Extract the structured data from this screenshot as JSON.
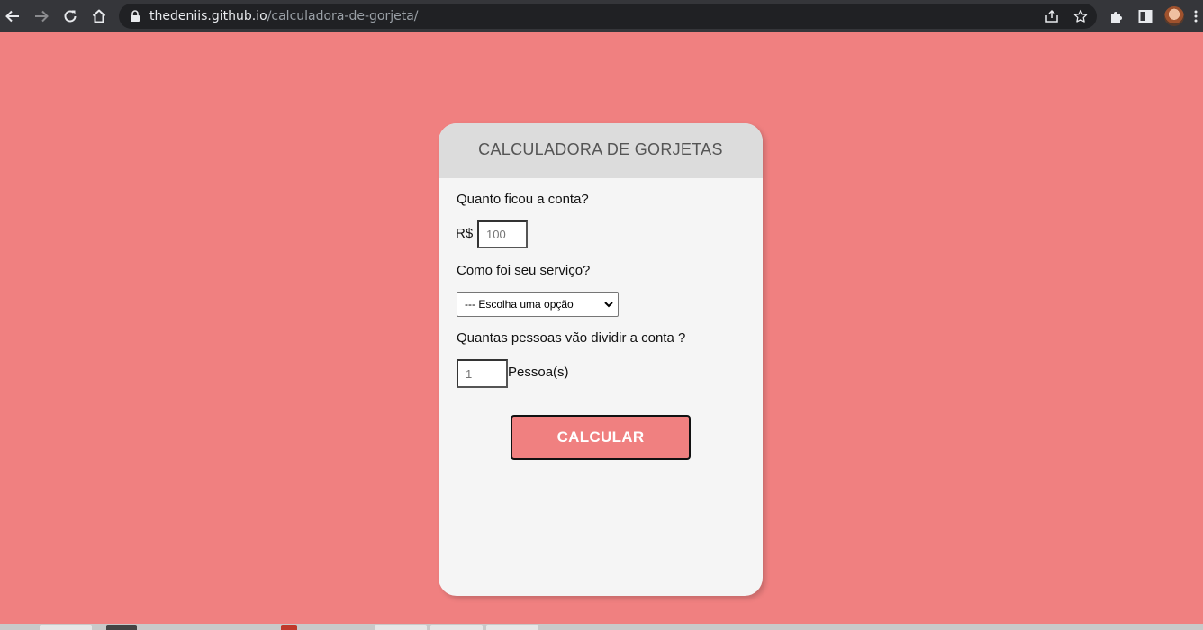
{
  "browser": {
    "url_host": "thedeniis.github.io",
    "url_path": "/calculadora-de-gorjeta/",
    "icons": {
      "back": "arrow-left-icon",
      "forward": "arrow-right-icon",
      "reload": "reload-icon",
      "home": "home-icon",
      "lock": "lock-icon",
      "share": "share-icon",
      "bookmark": "star-icon",
      "extensions": "puzzle-icon",
      "side_panel": "side-panel-icon",
      "profile": "avatar",
      "menu": "kebab-menu-icon"
    },
    "colors": {
      "toolbar": "#35363a",
      "omnibox": "#202124"
    }
  },
  "card": {
    "title": "CALCULADORA DE GORJETAS",
    "bill_question": "Quanto ficou a conta?",
    "currency": "R$",
    "bill_placeholder": "100",
    "service_question": "Como foi seu serviço?",
    "service_selected": "--- Escolha uma opção",
    "people_question": "Quantas pessoas vão dividir a conta ?",
    "people_placeholder": "1",
    "people_suffix": "Pessoa(s)",
    "calculate_label": "CALCULAR"
  },
  "colors": {
    "page_background": "#f08080",
    "card_background": "#f5f5f5",
    "card_header": "#dcdcdc",
    "button_background": "#f08080",
    "button_text": "#ffffff"
  }
}
